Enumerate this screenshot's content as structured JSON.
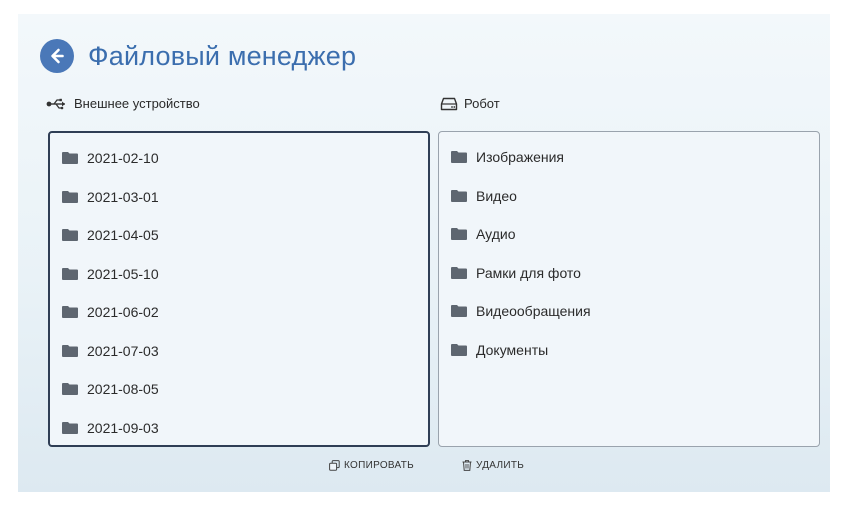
{
  "header": {
    "title": "Файловый менеджер"
  },
  "panes": {
    "external": {
      "label": "Внешнее устройство",
      "items": [
        "2021-02-10",
        "2021-03-01",
        "2021-04-05",
        "2021-05-10",
        "2021-06-02",
        "2021-07-03",
        "2021-08-05",
        "2021-09-03"
      ]
    },
    "robot": {
      "label": "Робот",
      "items": [
        "Изображения",
        "Видео",
        "Аудио",
        "Рамки для фото",
        "Видеообращения",
        "Документы"
      ]
    }
  },
  "actions": {
    "copy": "КОПИРОВАТЬ",
    "delete": "УДАЛИТЬ"
  },
  "icons": {
    "back": "arrow-left-icon",
    "usb": "usb-icon",
    "drive": "hard-drive-icon",
    "folder": "folder-icon",
    "copy": "copy-icon",
    "delete": "trash-icon"
  },
  "colors": {
    "accent": "#4a78b8",
    "title": "#3b6eae",
    "folder": "#5e6670",
    "selected_border": "#2f3e55"
  }
}
